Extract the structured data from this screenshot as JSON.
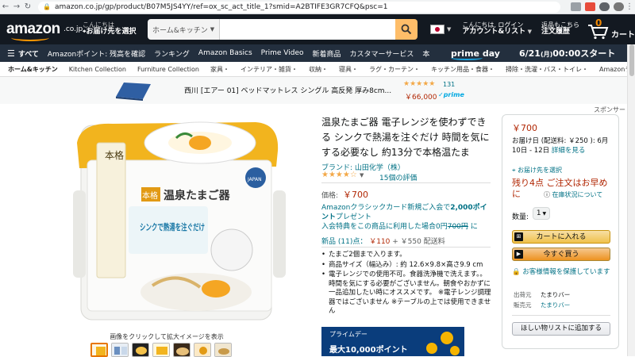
{
  "browser": {
    "url": "amazon.co.jp/gp/product/B07M5JS4YY/ref=ox_sc_act_title_1?smid=A2BTIFE3GR7CFQ&psc=1"
  },
  "header": {
    "logo": "amazon",
    "logo_tld": ".co.jp",
    "deliver_line1": "こんにちは",
    "deliver_line2": "お届け先を選択",
    "search_category": "ホーム&キッチン",
    "search_placeholder": "",
    "account_line1": "こんにちは, ログイン",
    "account_line2": "アカウント&リスト",
    "orders_line1": "返品もこちら",
    "orders_line2": "注文履歴",
    "cart_count": "0",
    "cart_label": "カート"
  },
  "nav": {
    "all_label": "すべて",
    "items": [
      "Amazonポイント: 残高を確認",
      "ランキング",
      "Amazon Basics",
      "Prime Video",
      "新着商品",
      "カスタマーサービス",
      "本"
    ],
    "prime_day": "prime day",
    "prime_day_date": "6/21",
    "prime_day_weekday": "(月)",
    "prime_day_time": "00:00スタート"
  },
  "subnav": {
    "items": [
      "ホーム&キッチン",
      "Kitchen Collection",
      "Furniture Collection",
      "家具・",
      "インテリア・雑貨・",
      "収納・",
      "寝具・",
      "ラグ・カーテン・",
      "キッチン用品・食器・",
      "掃除・洗濯・バス・トイレ・",
      "Amazonランキング"
    ]
  },
  "ad": {
    "title": "西川 [エアー 01] ベッドマットレス シングル 高反発 厚み8cm...",
    "stars": "★★★★★",
    "rating_count": "131",
    "price": "￥66,000",
    "prime": "✓prime"
  },
  "sponsor_label": "スポンサー",
  "product": {
    "image_caption": "画像をクリックして拡大イメージを表示",
    "image_text_top": "温泉たまご器",
    "image_badge": "本格",
    "image_text_mid": "シンクで熱湯を注ぐだけ",
    "image_brand_badge": "JAPAN",
    "title": "温泉たまご器 電子レンジを使わずできる シンクで熱湯を注ぐだけ 時間を気にする必要なし 約13分で本格温たま",
    "brand": "ブランド: 山田化学（株）",
    "stars": "★★★★☆",
    "reviews": "15個の評価",
    "price_label": "価格:",
    "price": "￥700",
    "card_line1": "Amazonクラシックカード新規ご入会で",
    "card_points": "2,000ポイント",
    "card_line1b": "プレゼント",
    "card_line2": "入会特典をこの商品に利用した場合0円",
    "card_line2_strike": "700円",
    "card_line2_end": "に",
    "new_offers_label": "新品 (11)点：",
    "new_offers_price": "￥110",
    "new_offers_plus": "+ ￥550 配送料",
    "bullets": [
      "たまご2個まで入ります。",
      "商品サイズ（幅込み）: 約 12.6×9.8×高さ9.9 cm",
      "電子レンジでの使用不可。食器洗浄機で洗えます。。時間を気にする必要がございません。朝食やおかずに一品追加したい時にオススメです。 ※電子レンジ調理器ではございません ※テーブルの上では使用できません"
    ],
    "promo_line1": "プライムデー",
    "promo_line2": "最大10,000ポイント"
  },
  "buybox": {
    "price": "￥700",
    "shipping": "お届け日 (配送料: ￥250 ): 6月10日 - 12日",
    "shipping_link": "詳細を見る",
    "deliver_to": "お届け先を選択",
    "stock": "残り4点 ご注文はお早めに",
    "stock_sub_icon": "ⓘ",
    "stock_sub": "在庫状況について",
    "qty_label": "数量:",
    "qty_value": "1",
    "add_to_cart": "カートに入れる",
    "buy_now": "今すぐ買う",
    "secure": "お客様情報を保護しています",
    "ships_from_label": "出荷元",
    "ships_from": "たまりバー",
    "sold_by_label": "販売元",
    "sold_by": "たまりバー",
    "wishlist": "ほしい物リストに追加する"
  },
  "colors": {
    "header_bg": "#131921",
    "nav_bg": "#232f3e",
    "accent_orange": "#febd69",
    "price_red": "#b12704",
    "link_teal": "#007185"
  }
}
